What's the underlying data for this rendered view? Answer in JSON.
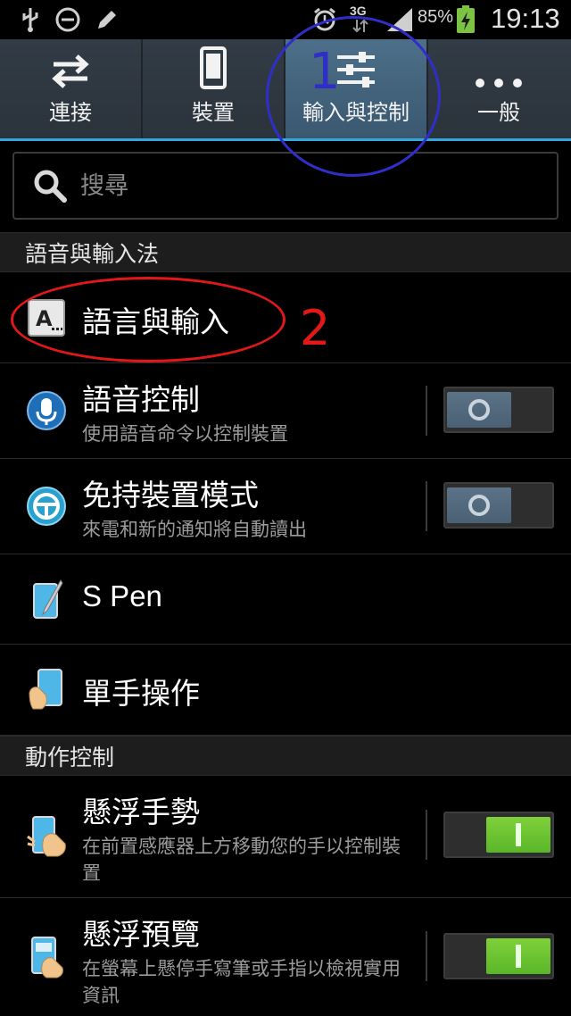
{
  "status_bar": {
    "network": "3G",
    "battery_percent": "85%",
    "time": "19:13"
  },
  "tabs": [
    {
      "label": "連接",
      "icon": "swap-arrows-icon",
      "active": false
    },
    {
      "label": "裝置",
      "icon": "phone-icon",
      "active": false
    },
    {
      "label": "輸入與控制",
      "icon": "sliders-icon",
      "active": true
    },
    {
      "label": "一般",
      "icon": "more-dots-icon",
      "active": false
    }
  ],
  "search": {
    "placeholder": "搜尋"
  },
  "sections": [
    {
      "header": "語音與輸入法",
      "items": [
        {
          "title": "語言與輸入",
          "icon": "language-keyboard-icon"
        },
        {
          "title": "語音控制",
          "subtitle": "使用語音命令以控制裝置",
          "icon": "microphone-icon",
          "toggle": "off"
        },
        {
          "title": "免持裝置模式",
          "subtitle": "來電和新的通知將自動讀出",
          "icon": "steering-wheel-icon",
          "toggle": "off"
        },
        {
          "title": "S Pen",
          "icon": "s-pen-icon"
        },
        {
          "title": "單手操作",
          "icon": "one-hand-icon"
        }
      ]
    },
    {
      "header": "動作控制",
      "items": [
        {
          "title": "懸浮手勢",
          "subtitle": "在前置感應器上方移動您的手以控制裝置",
          "icon": "air-gesture-icon",
          "toggle": "on"
        },
        {
          "title": "懸浮預覽",
          "subtitle": "在螢幕上懸停手寫筆或手指以檢視實用資訊",
          "icon": "air-view-icon",
          "toggle": "on"
        }
      ]
    }
  ],
  "annotations": {
    "label_1": "1",
    "label_2": "2",
    "color_1": "#2f2fc8",
    "color_2": "#e01818"
  },
  "colors": {
    "accent": "#35a6d9",
    "toggle_on": "#6cc52f",
    "toggle_off": "#52697e"
  }
}
